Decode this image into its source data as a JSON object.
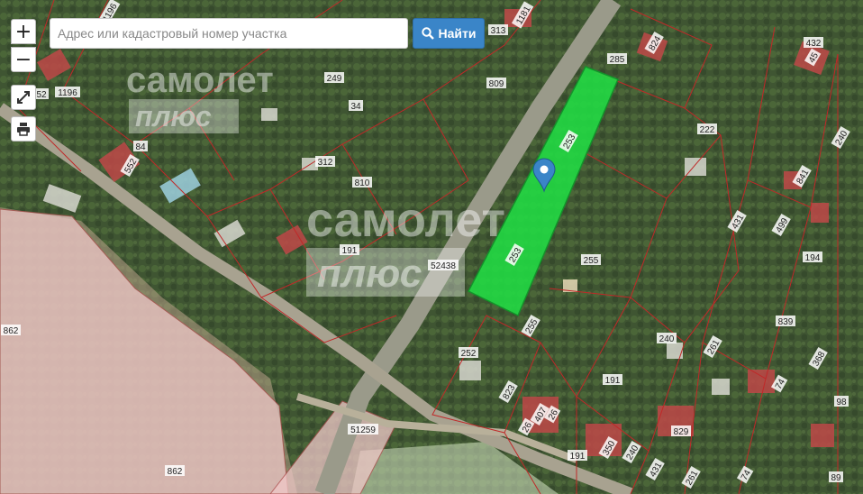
{
  "search": {
    "placeholder": "Адрес или кадастровый номер участка",
    "button_label": "Найти"
  },
  "controls": {
    "zoom_in": "+",
    "zoom_out": "−"
  },
  "watermark": {
    "line1": "самолет",
    "line2": "плюс"
  },
  "parcel_labels": [
    "1196",
    "1181",
    "313",
    "285",
    "824",
    "432",
    "45",
    "52",
    "1196",
    "249",
    "809",
    "34",
    "222",
    "240",
    "84",
    "552",
    "312",
    "810",
    "253",
    "431",
    "841",
    "499",
    "194",
    "191",
    "253",
    "52438",
    "255",
    "862",
    "255",
    "252",
    "240",
    "839",
    "261",
    "368",
    "823",
    "191",
    "74",
    "98",
    "26",
    "407",
    "26",
    "829",
    "350",
    "51259",
    "191",
    "240",
    "431",
    "261",
    "74",
    "89",
    "862"
  ],
  "colors": {
    "selected_parcel": "#22dd44",
    "search_button": "#3a85c8",
    "marker": "#3a85c8"
  }
}
